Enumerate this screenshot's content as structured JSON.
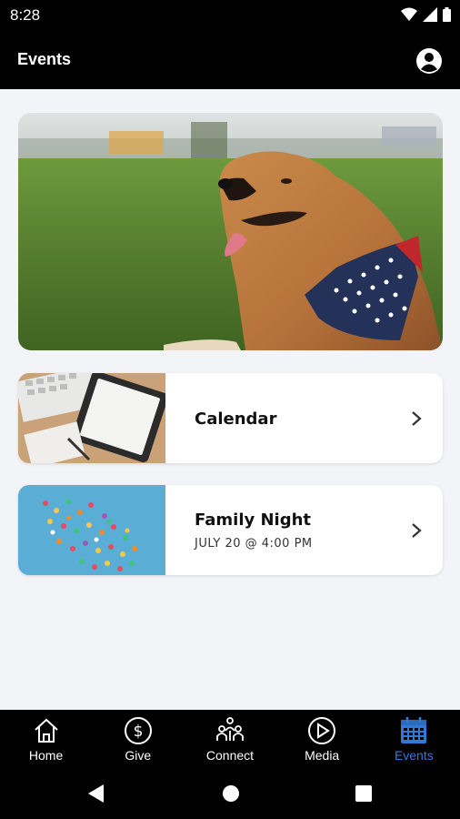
{
  "status_bar": {
    "time": "8:28"
  },
  "app_bar": {
    "title": "Events"
  },
  "hero": {
    "alt": "dog-photo"
  },
  "cards": [
    {
      "title": "Calendar",
      "subtitle": ""
    },
    {
      "title": "Family Night",
      "subtitle": "JULY 20 @ 4:00 PM"
    }
  ],
  "nav": [
    {
      "label": "Home",
      "icon": "home-icon"
    },
    {
      "label": "Give",
      "icon": "dollar-icon"
    },
    {
      "label": "Connect",
      "icon": "people-icon"
    },
    {
      "label": "Media",
      "icon": "play-icon"
    },
    {
      "label": "Events",
      "icon": "calendar-icon",
      "active": true
    }
  ],
  "colors": {
    "active": "#2f7ad6",
    "background": "#f3f4f8"
  }
}
